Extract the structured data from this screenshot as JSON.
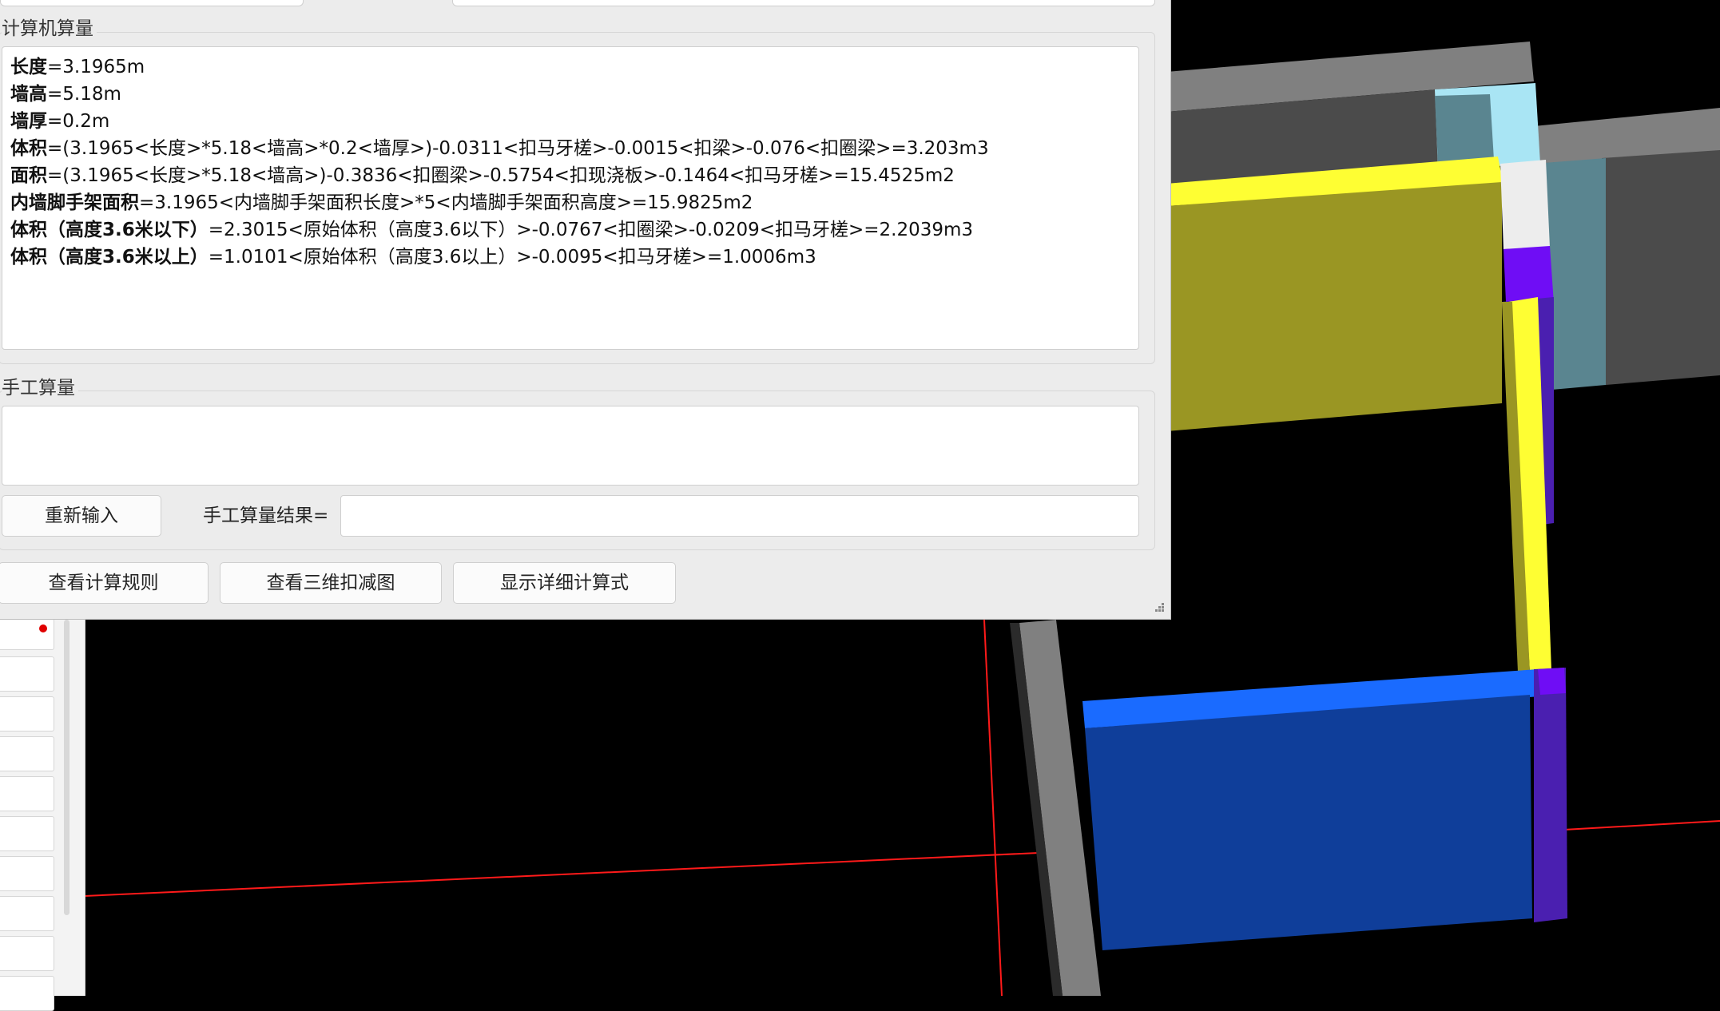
{
  "computer_group": {
    "title": "计算机算量",
    "lines": [
      {
        "label": "长度",
        "expr": "=3.1965m"
      },
      {
        "label": "墙高",
        "expr": "=5.18m"
      },
      {
        "label": "墙厚",
        "expr": "=0.2m"
      },
      {
        "label": "体积",
        "expr": "=(3.1965<长度>*5.18<墙高>*0.2<墙厚>)-0.0311<扣马牙槎>-0.0015<扣梁>-0.076<扣圈梁>=3.203m3"
      },
      {
        "label": "面积",
        "expr": "=(3.1965<长度>*5.18<墙高>)-0.3836<扣圈梁>-0.5754<扣现浇板>-0.1464<扣马牙槎>=15.4525m2"
      },
      {
        "label": "内墙脚手架面积",
        "expr": "=3.1965<内墙脚手架面积长度>*5<内墙脚手架面积高度>=15.9825m2"
      },
      {
        "label": "体积（高度3.6米以下）",
        "expr": "=2.3015<原始体积（高度3.6以下）>-0.0767<扣圈梁>-0.0209<扣马牙槎>=2.2039m3"
      },
      {
        "label": "体积（高度3.6米以上）",
        "expr": "=1.0101<原始体积（高度3.6以上）>-0.0095<扣马牙槎>=1.0006m3"
      }
    ]
  },
  "manual_group": {
    "title": "手工算量",
    "input_value": "",
    "reset_label": "重新输入",
    "result_label": "手工算量结果=",
    "result_value": ""
  },
  "footer": {
    "view_rules": "查看计算规则",
    "view_3d": "查看三维扣减图",
    "show_detail": "显示详细计算式"
  },
  "colors": {
    "panel_bg": "#ececec",
    "wall_yellow": "#fefe33",
    "wall_olive": "#9a9623",
    "wall_blue": "#0f3e9a",
    "wall_blue_top": "#1a6bff",
    "wall_purple": "#6f0df5",
    "wall_grey": "#4c4c4c",
    "wall_cyan": "#a9e5f4",
    "axis_red": "#ff1a1a"
  },
  "icons": [
    "resize-grip-icon",
    "red-dot-marker"
  ]
}
